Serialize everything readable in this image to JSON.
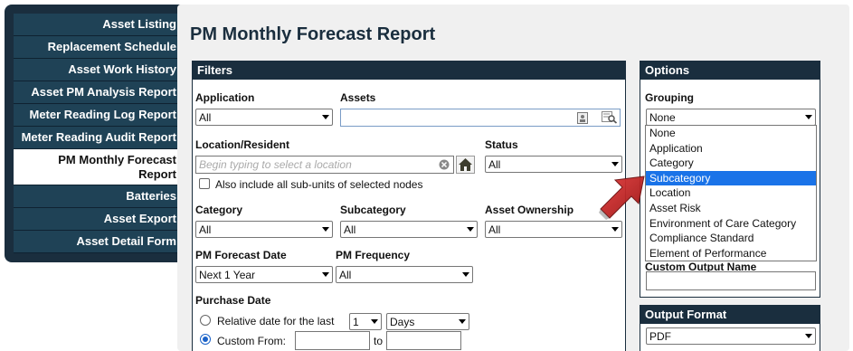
{
  "sidebar": {
    "items": [
      {
        "label": "Asset Listing"
      },
      {
        "label": "Replacement Schedule"
      },
      {
        "label": "Asset Work History"
      },
      {
        "label": "Asset PM Analysis Report"
      },
      {
        "label": "Meter Reading Log Report"
      },
      {
        "label": "Meter Reading Audit Report"
      },
      {
        "label": "PM Monthly Forecast Report"
      },
      {
        "label": "Batteries"
      },
      {
        "label": "Asset Export"
      },
      {
        "label": "Asset Detail Form"
      }
    ]
  },
  "page": {
    "title": "PM Monthly Forecast Report"
  },
  "filters": {
    "header": "Filters",
    "application": {
      "label": "Application",
      "value": "All"
    },
    "assets": {
      "label": "Assets",
      "value": ""
    },
    "location": {
      "label": "Location/Resident",
      "placeholder": "Begin typing to select a location"
    },
    "status": {
      "label": "Status",
      "value": "All"
    },
    "include_subunits": {
      "label": "Also include all sub-units of selected nodes",
      "checked": false
    },
    "category": {
      "label": "Category",
      "value": "All"
    },
    "subcategory": {
      "label": "Subcategory",
      "value": "All"
    },
    "ownership": {
      "label": "Asset Ownership",
      "value": "All"
    },
    "forecast_date": {
      "label": "PM Forecast Date",
      "value": "Next 1 Year"
    },
    "frequency": {
      "label": "PM Frequency",
      "value": "All"
    },
    "purchase_date": {
      "label": "Purchase Date",
      "relative_label": "Relative date for the last",
      "relative_number": "1",
      "relative_unit": "Days",
      "custom_label": "Custom From:",
      "to_label": "to",
      "from_value": "",
      "to_value": "",
      "mode": "custom"
    }
  },
  "options": {
    "header": "Options",
    "grouping": {
      "label": "Grouping",
      "value": "None",
      "options": [
        "None",
        "Application",
        "Category",
        "Subcategory",
        "Location",
        "Asset Risk",
        "Environment of Care Category",
        "Compliance Standard",
        "Element of Performance"
      ],
      "highlighted": "Subcategory"
    },
    "custom_output_name": {
      "label": "Custom Output Name",
      "value": ""
    }
  },
  "output": {
    "header": "Output Format",
    "value": "PDF"
  },
  "colors": {
    "sidebar_bg": "#1a2e3e",
    "sidebar_item": "#1f4256",
    "accent_blue": "#1a73e8",
    "pointer_red": "#c41e1e"
  },
  "icons": {
    "assets_picker": "contact-card-icon",
    "assets_search": "search-list-icon",
    "clear": "clear-circle-icon",
    "home": "home-icon",
    "pointer": "red-arrow-icon"
  }
}
